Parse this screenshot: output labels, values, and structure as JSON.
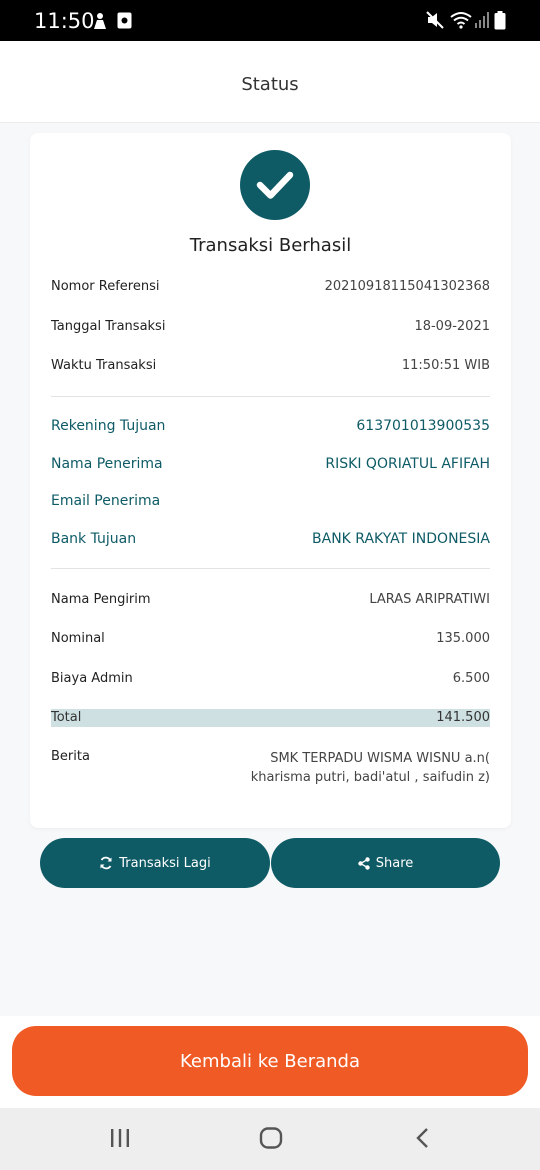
{
  "status_bar": {
    "time": "11:50"
  },
  "header": {
    "title": "Status"
  },
  "result": {
    "heading": "Transaksi Berhasil"
  },
  "meta": [
    {
      "label": "Nomor Referensi",
      "value": "20210918115041302368"
    },
    {
      "label": "Tanggal Transaksi",
      "value": "18-09-2021"
    },
    {
      "label": "Waktu Transaksi",
      "value": "11:50:51 WIB"
    }
  ],
  "recipient": [
    {
      "label": "Rekening Tujuan",
      "value": "613701013900535"
    },
    {
      "label": "Nama Penerima",
      "value": "RISKI QORIATUL AFIFAH"
    },
    {
      "label": "Email Penerima",
      "value": ""
    },
    {
      "label": "Bank Tujuan",
      "value": "BANK RAKYAT INDONESIA"
    }
  ],
  "payment": [
    {
      "label": "Nama Pengirim",
      "value": "LARAS ARIPRATIWI"
    },
    {
      "label": "Nominal",
      "value": "135.000"
    },
    {
      "label": "Biaya Admin",
      "value": "6.500"
    }
  ],
  "total": {
    "label": "Total",
    "value": "141.500"
  },
  "berita": {
    "label": "Berita",
    "line1": "SMK TERPADU WISMA WISNU a.n(",
    "line2": "kharisma putri, badi'atul , saifudin z)"
  },
  "actions": {
    "retry_label": "Transaksi Lagi",
    "share_label": "Share"
  },
  "footer": {
    "home_label": "Kembali ke Beranda"
  },
  "colors": {
    "primary": "#0e5b66",
    "accent": "#f05a24",
    "total_highlight": "#cfe0e2"
  },
  "icons": [
    "check-icon",
    "refresh-icon",
    "share-icon",
    "recent-apps-icon",
    "home-icon",
    "back-icon",
    "wifi-icon",
    "signal-icon",
    "battery-icon",
    "mute-icon"
  ]
}
